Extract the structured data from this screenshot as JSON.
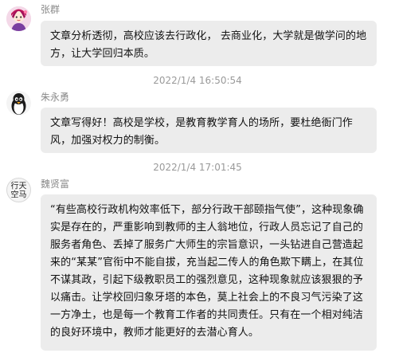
{
  "messages": [
    {
      "author": "张群",
      "avatar_icon": "pink-cartoon-avatar-icon",
      "text": "文章分析透彻，高校应该去行政化， 去商业化，大学就是做学问的地方，让大学回归本质。",
      "timestamp": "2022/1/4 16:50:54"
    },
    {
      "author": "朱永勇",
      "avatar_icon": "penguin-avatar-icon",
      "text": "文章写得好！高校是学校，是教育教学育人的场所，要杜绝衙门作风，加强对权力的制衡。",
      "timestamp": "2022/1/4 17:01:45"
    },
    {
      "author": "魏贤富",
      "avatar_icon": "calligraphy-avatar-icon",
      "avatar_text": "行天空马",
      "text": "“有些高校行政机构效率低下，部分行政干部颐指气使”，这种现象确实是存在的，严重影响到教师的主人翁地位，行政人员忘记了自己的服务者角色、丢掉了服务广大师生的宗旨意识，一头钻进自己营造起来的“某某”官衔中不能自拔，充当起二传人的角色欺下瞒上，在其位不谋其政，引起下级教职员工的强烈意见，这种现象就应该狠狠的予以痛击。让学校回归象牙塔的本色，莫上社会上的不良习气污染了这一方净土，也是每一个教育工作者的共同责任。只有在一个相对纯洁的良好环境中，教师才能更好的去潜心育人。"
    }
  ],
  "colors": {
    "bubble": "#ececec",
    "name": "#8a8a8a",
    "time": "#9a9a9a",
    "text": "#111111"
  }
}
